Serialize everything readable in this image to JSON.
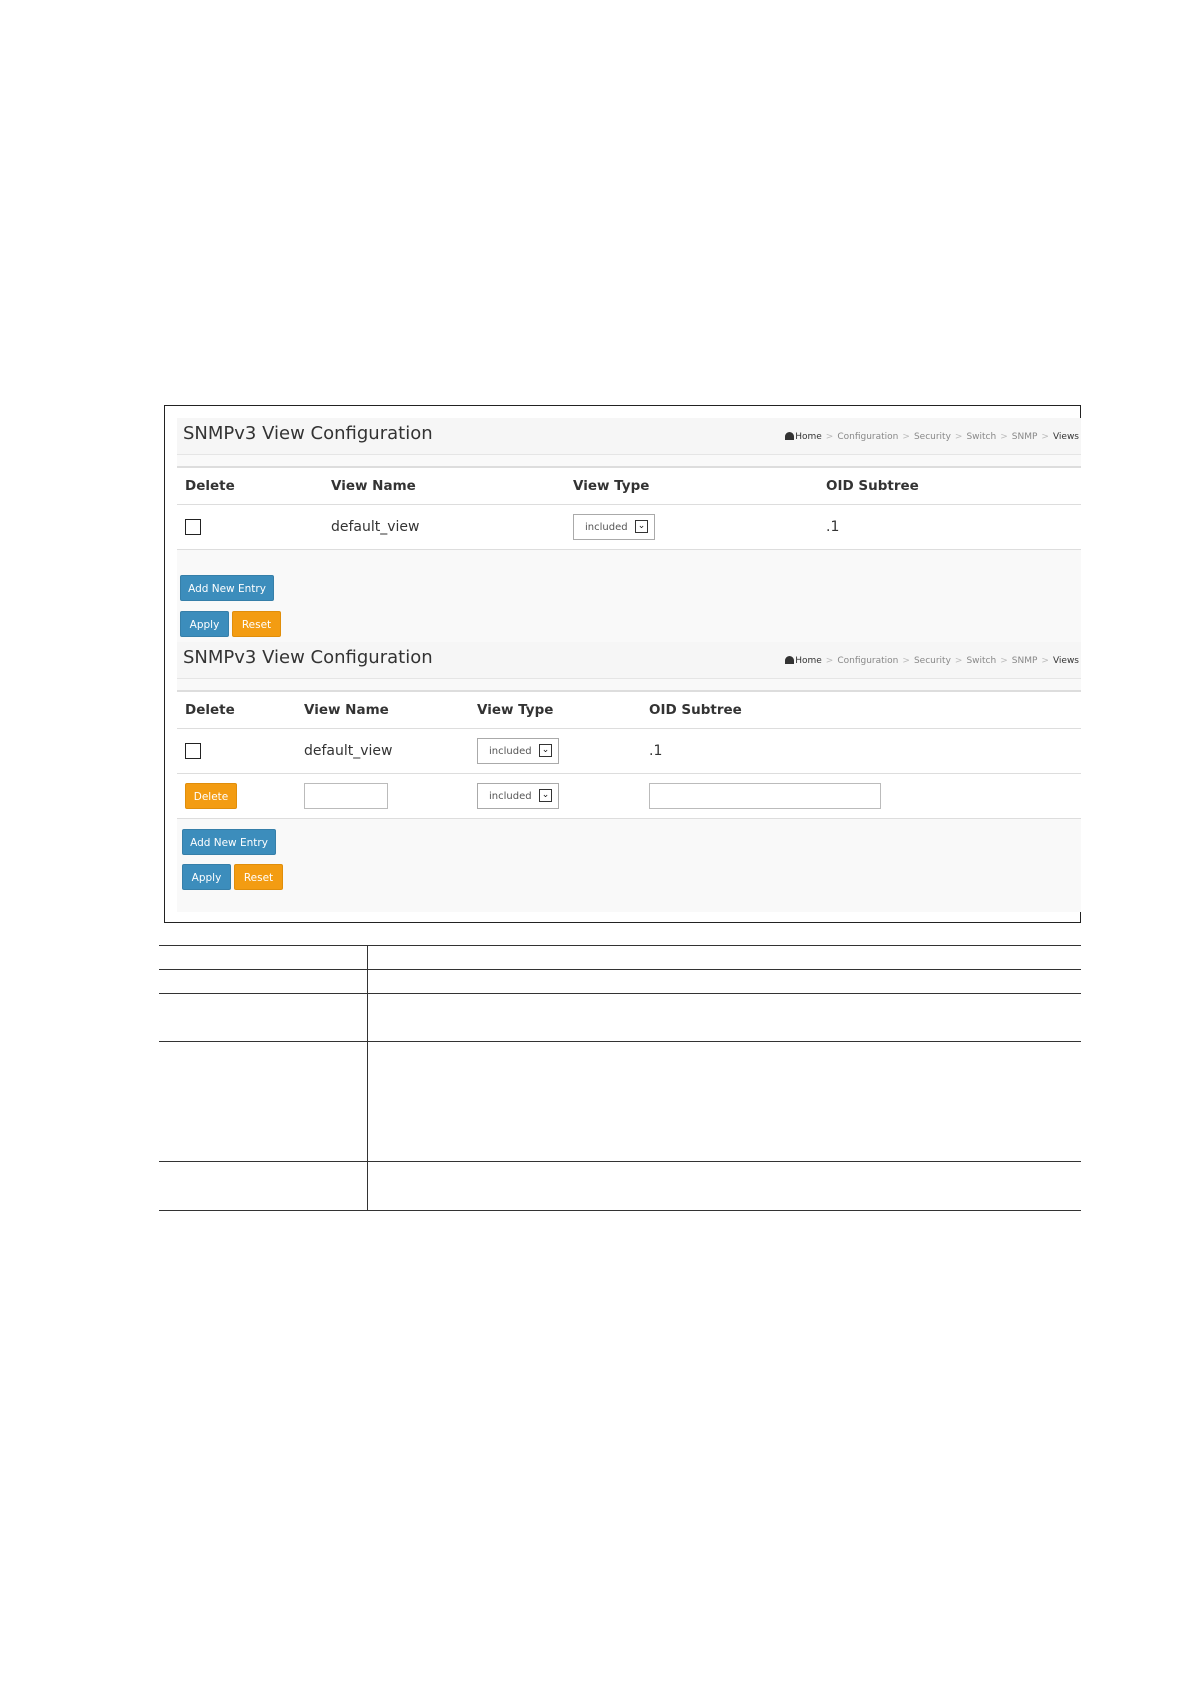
{
  "panel1": {
    "title": "SNMPv3 View Configuration",
    "breadcrumbs": {
      "home": "Home",
      "items": [
        "Configuration",
        "Security",
        "Switch",
        "SNMP"
      ],
      "current": "Views"
    },
    "columns": [
      "Delete",
      "View Name",
      "View Type",
      "OID Subtree"
    ],
    "row": {
      "view_name": "default_view",
      "view_type": "included",
      "oid_subtree": ".1"
    },
    "add_button": "Add New Entry",
    "apply_button": "Apply",
    "reset_button": "Reset"
  },
  "panel2": {
    "title": "SNMPv3 View Configuration",
    "breadcrumbs": {
      "home": "Home",
      "items": [
        "Configuration",
        "Security",
        "Switch",
        "SNMP"
      ],
      "current": "Views"
    },
    "columns": [
      "Delete",
      "View Name",
      "View Type",
      "OID Subtree"
    ],
    "row": {
      "view_name": "default_view",
      "view_type": "included",
      "oid_subtree": ".1"
    },
    "new_row": {
      "delete_button": "Delete",
      "view_name": "",
      "view_type": "included",
      "oid_subtree": ""
    },
    "add_button": "Add New Entry",
    "apply_button": "Apply",
    "reset_button": "Reset"
  },
  "icons": {
    "home": "home-icon",
    "dropdown": "chevron-down-icon",
    "checkbox": "checkbox-unchecked-icon"
  },
  "colors": {
    "primary_button": "#3c8dbc",
    "warning_button": "#f39c12"
  }
}
